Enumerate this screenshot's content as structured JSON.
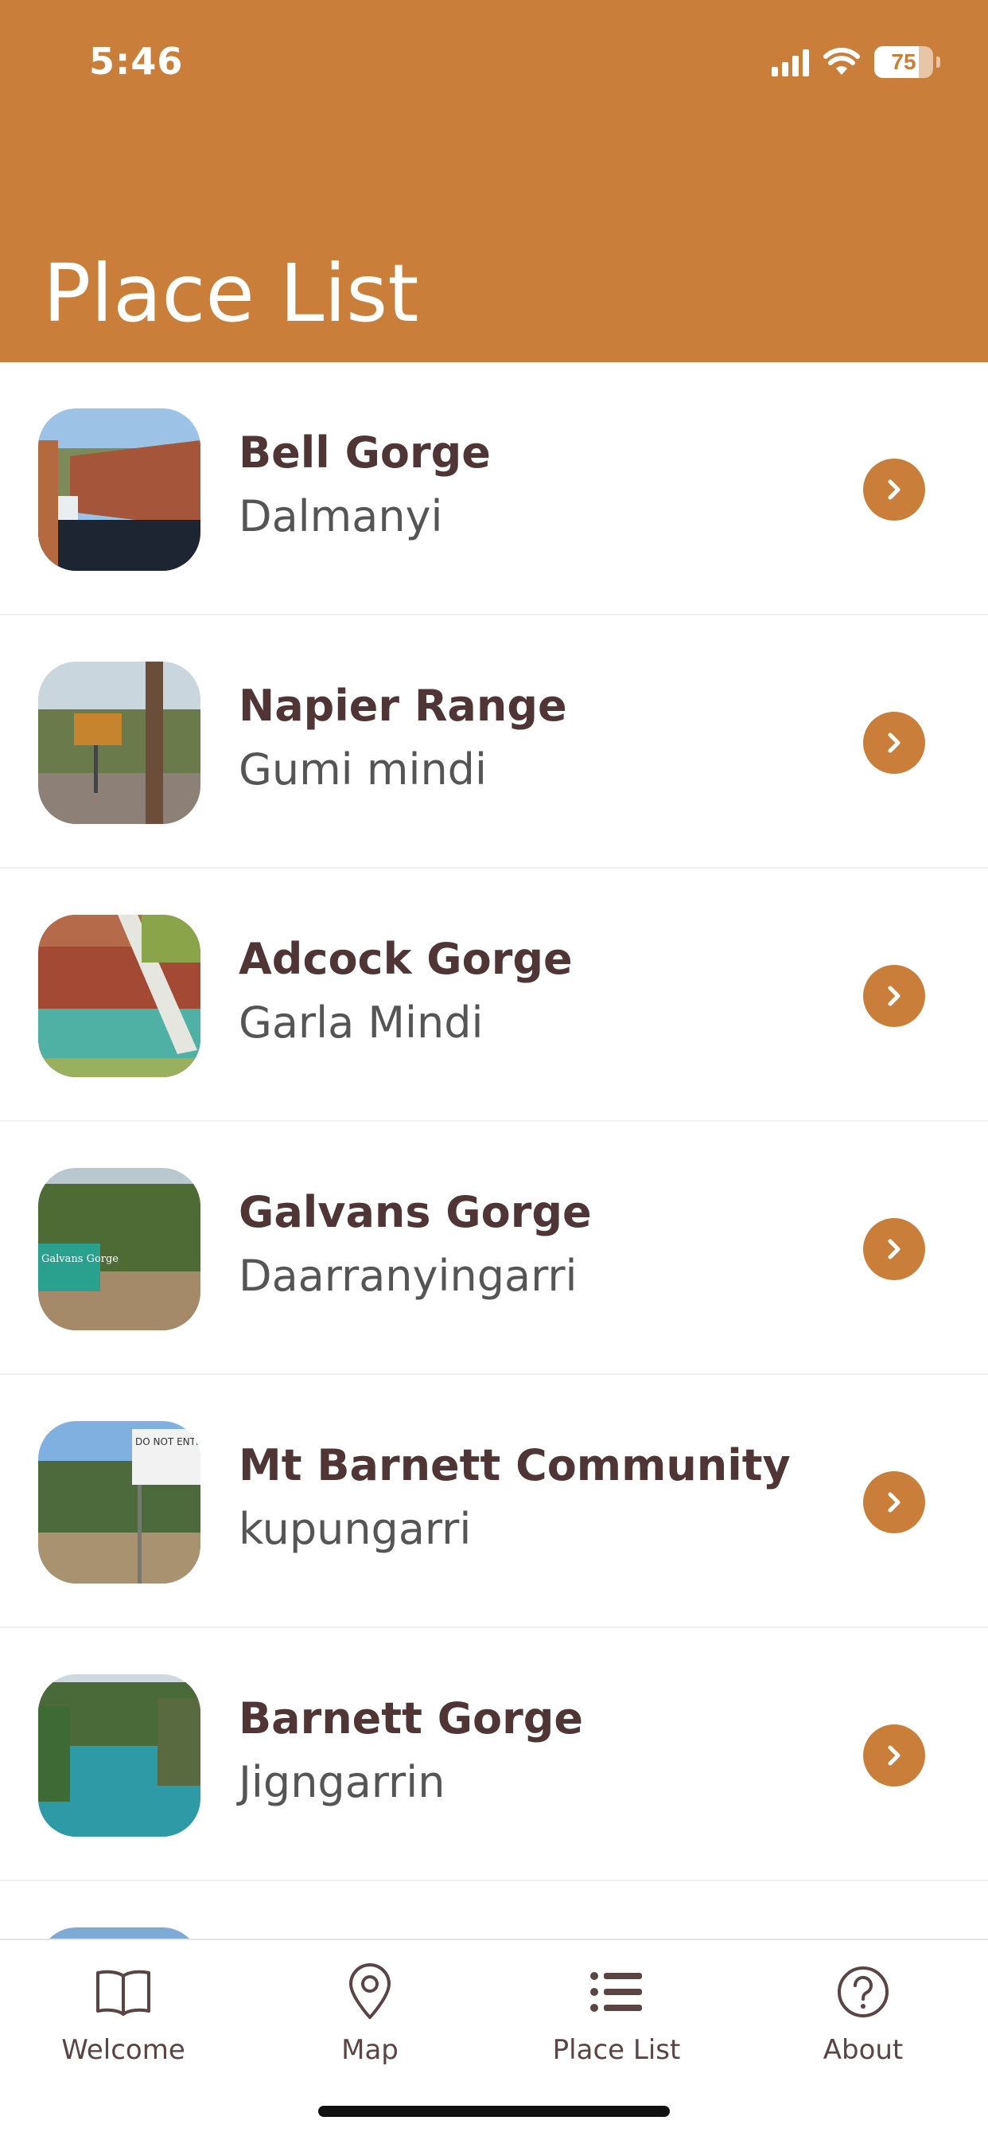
{
  "status": {
    "time": "5:46",
    "battery": "75",
    "battery_level": 0.75
  },
  "header": {
    "title": "Place List"
  },
  "places": [
    {
      "name": "Bell Gorge",
      "alt": "Dalmanyi"
    },
    {
      "name": "Napier Range",
      "alt": "Gumi mindi"
    },
    {
      "name": "Adcock Gorge",
      "alt": "Garla Mindi"
    },
    {
      "name": "Galvans Gorge",
      "alt": "Daarranyingarri"
    },
    {
      "name": "Mt Barnett Community",
      "alt": "kupungarri"
    },
    {
      "name": "Barnett Gorge",
      "alt": "Jigngarrin"
    }
  ],
  "thumb_text": {
    "galvans_sign": "Galvans Gorge",
    "barnett_sign": "DO NOT ENTER"
  },
  "tabs": [
    {
      "label": "Welcome",
      "icon": "book-icon"
    },
    {
      "label": "Map",
      "icon": "map-pin-icon"
    },
    {
      "label": "Place List",
      "icon": "list-icon",
      "active": true
    },
    {
      "label": "About",
      "icon": "help-circle-icon"
    }
  ],
  "colors": {
    "accent": "#C97F3A",
    "text_dark": "#4F3535",
    "text_muted": "#555555"
  }
}
